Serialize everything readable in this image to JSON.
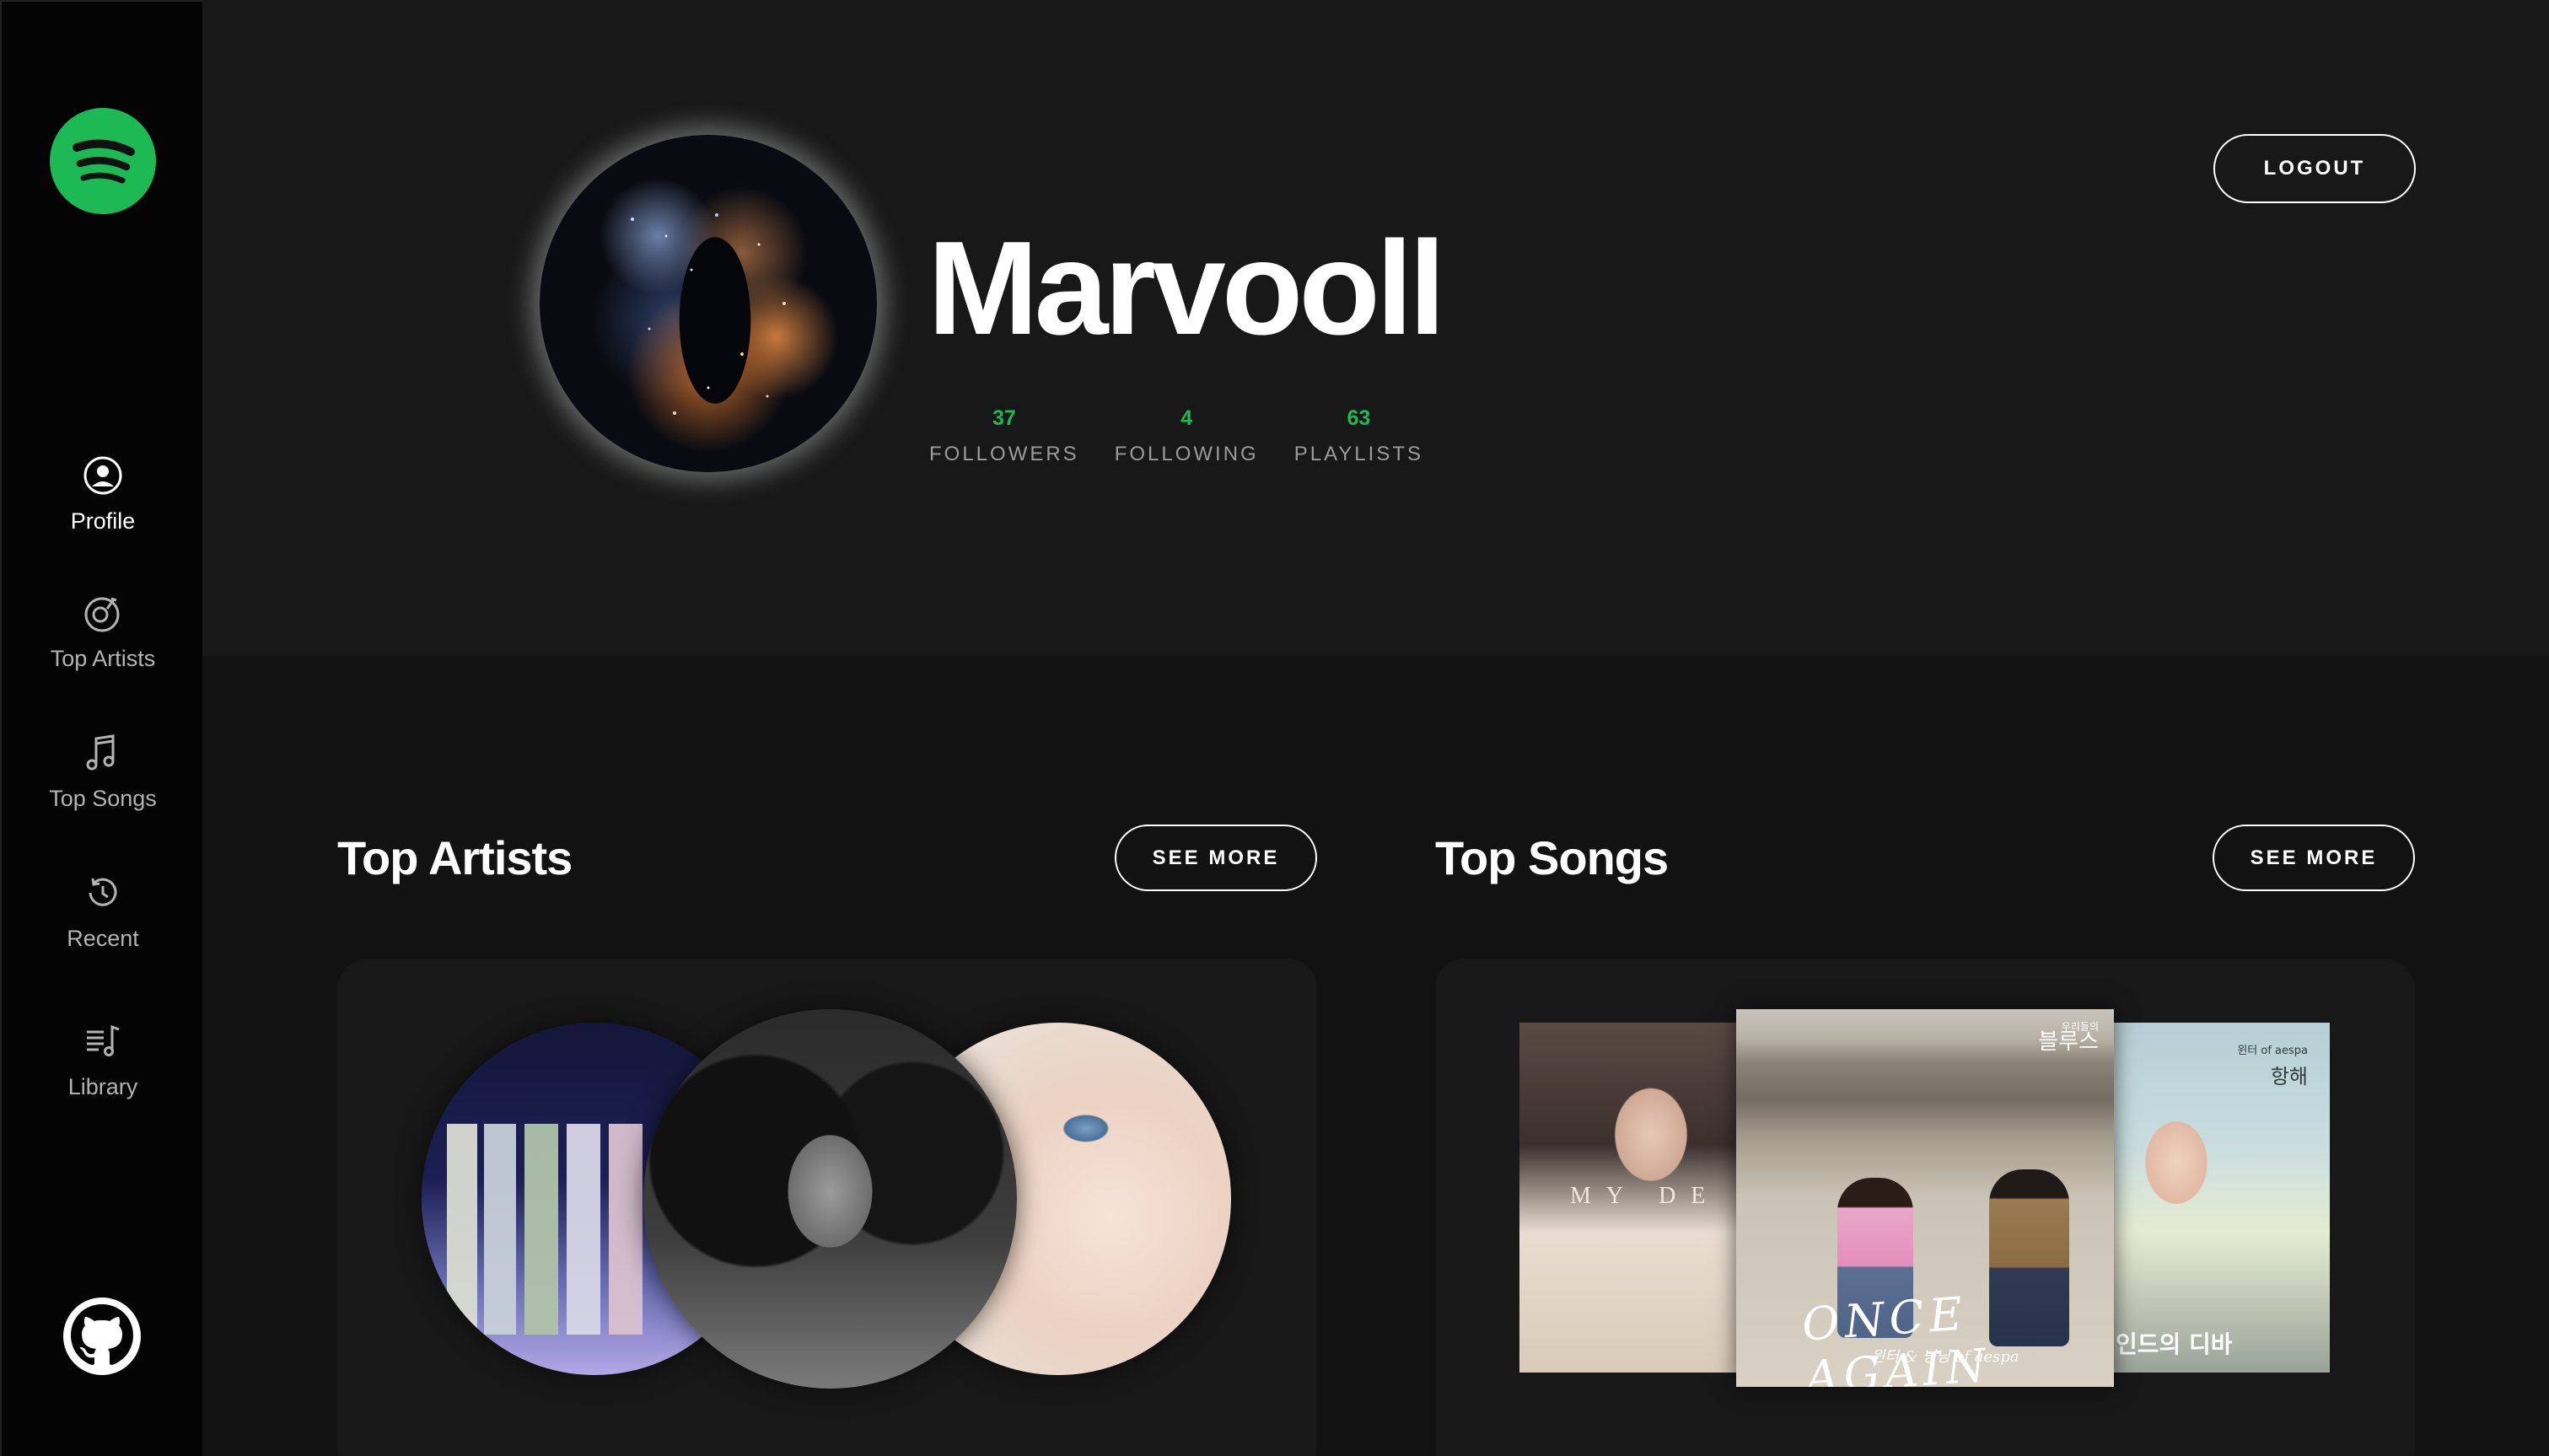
{
  "sidebar": {
    "nav": [
      {
        "label": "Profile",
        "icon": "user-circle-icon",
        "active": true
      },
      {
        "label": "Top Artists",
        "icon": "microphone-icon"
      },
      {
        "label": "Top Songs",
        "icon": "music-note-icon"
      },
      {
        "label": "Recent",
        "icon": "history-icon"
      },
      {
        "label": "Library",
        "icon": "library-icon"
      }
    ],
    "logo_icon": "spotify-logo-icon",
    "github_icon": "github-icon"
  },
  "profile": {
    "display_name": "Marvooll",
    "stats": [
      {
        "value": "37",
        "label": "FOLLOWERS"
      },
      {
        "value": "4",
        "label": "FOLLOWING"
      },
      {
        "value": "63",
        "label": "PLAYLISTS"
      }
    ],
    "logout_label": "LOGOUT"
  },
  "top_artists": {
    "title": "Top Artists",
    "see_more_label": "SEE MORE"
  },
  "top_songs": {
    "title": "Top Songs",
    "see_more_label": "SEE MORE",
    "covers": [
      {
        "text": "MY DE"
      },
      {
        "header_small": "우리들의",
        "header": "블루스",
        "title": "ONCE AGAIN",
        "subtitle": "윈터 & 닝닝 of aespa"
      },
      {
        "tag": "윈터 of aespa",
        "tag_big": "항해",
        "bottom": "인드의 디바"
      }
    ]
  },
  "colors": {
    "accent": "#1db954",
    "background": "#121212",
    "header_bg": "#181818",
    "sidebar_bg": "#040404",
    "card_bg": "#181818"
  }
}
